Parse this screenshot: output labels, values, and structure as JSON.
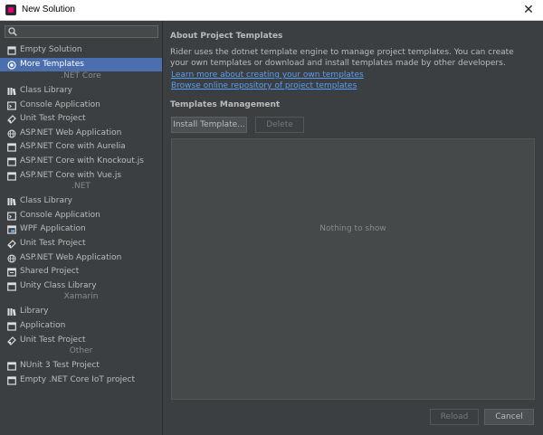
{
  "window": {
    "title": "New Solution"
  },
  "sidebar": {
    "search_placeholder": "",
    "top_items": [
      {
        "label": "Empty Solution",
        "icon": "empty-solution-icon",
        "selected": false
      },
      {
        "label": "More Templates",
        "icon": "more-templates-icon",
        "selected": true
      }
    ],
    "sections": [
      {
        "title": ".NET Core",
        "items": [
          {
            "label": "Class Library",
            "icon": "class-library-icon"
          },
          {
            "label": "Console Application",
            "icon": "console-app-icon"
          },
          {
            "label": "Unit Test Project",
            "icon": "unit-test-icon"
          },
          {
            "label": "ASP.NET Web Application",
            "icon": "web-app-icon"
          },
          {
            "label": "ASP.NET Core with Aurelia",
            "icon": "window-icon"
          },
          {
            "label": "ASP.NET Core with Knockout.js",
            "icon": "window-icon"
          },
          {
            "label": "ASP.NET Core with Vue.js",
            "icon": "window-icon"
          }
        ]
      },
      {
        "title": ".NET",
        "items": [
          {
            "label": "Class Library",
            "icon": "class-library-icon"
          },
          {
            "label": "Console Application",
            "icon": "console-app-icon"
          },
          {
            "label": "WPF Application",
            "icon": "wpf-app-icon"
          },
          {
            "label": "Unit Test Project",
            "icon": "unit-test-icon"
          },
          {
            "label": "ASP.NET Web Application",
            "icon": "web-app-icon"
          },
          {
            "label": "Shared Project",
            "icon": "shared-project-icon"
          },
          {
            "label": "Unity Class Library",
            "icon": "window-icon"
          }
        ]
      },
      {
        "title": "Xamarin",
        "items": [
          {
            "label": "Library",
            "icon": "class-library-icon"
          },
          {
            "label": "Application",
            "icon": "window-icon"
          },
          {
            "label": "Unit Test Project",
            "icon": "unit-test-icon"
          }
        ]
      },
      {
        "title": "Other",
        "items": [
          {
            "label": "NUnit 3 Test Project",
            "icon": "window-icon"
          },
          {
            "label": "Empty .NET Core IoT project",
            "icon": "window-icon"
          }
        ]
      }
    ]
  },
  "main": {
    "about_title": "About Project Templates",
    "description": "Rider uses the dotnet template engine to manage project templates. You can create your own templates or download and install templates made by other developers.",
    "link_learn": "Learn more about creating your own templates",
    "link_browse": "Browse online repository of project templates",
    "management_title": "Templates Management",
    "install_label": "Install Template...",
    "delete_label": "Delete",
    "empty_text": "Nothing to show"
  },
  "footer": {
    "reload_label": "Reload",
    "cancel_label": "Cancel"
  },
  "colors": {
    "selection": "#4b6eaf",
    "link": "#589df6",
    "background": "#3c3f41"
  }
}
